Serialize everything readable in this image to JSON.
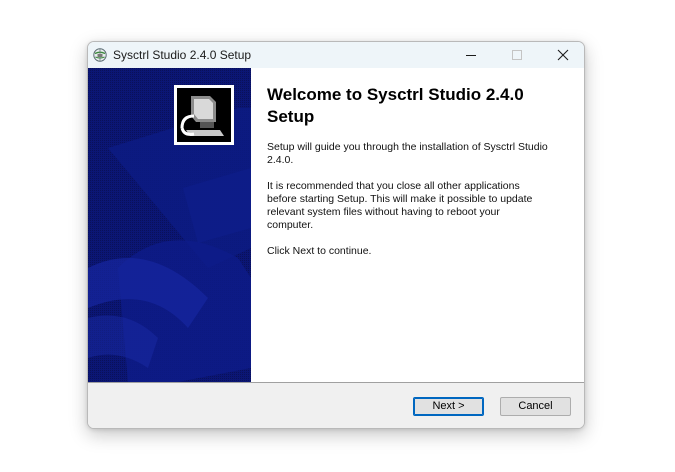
{
  "window": {
    "title": "Sysctrl Studio 2.4.0 Setup",
    "app_icon": "installer-globe-icon",
    "controls": [
      "minimize-icon",
      "maximize-icon",
      "close-icon"
    ]
  },
  "sidebar": {
    "background_color": "#0b1675",
    "logo_icon": "computer-installer-icon"
  },
  "content": {
    "heading": "Welcome to Sysctrl Studio 2.4.0 Setup",
    "paragraph1": "Setup will guide you through the installation of Sysctrl Studio 2.4.0.",
    "paragraph2": "It is recommended that you close all other applications before starting Setup. This will make it possible to update relevant system files without having to reboot your computer.",
    "paragraph3": "Click Next to continue."
  },
  "footer": {
    "next_label": "Next >",
    "cancel_label": "Cancel"
  },
  "colors": {
    "accent": "#0067c0",
    "titlebar": "#eef5f9"
  }
}
